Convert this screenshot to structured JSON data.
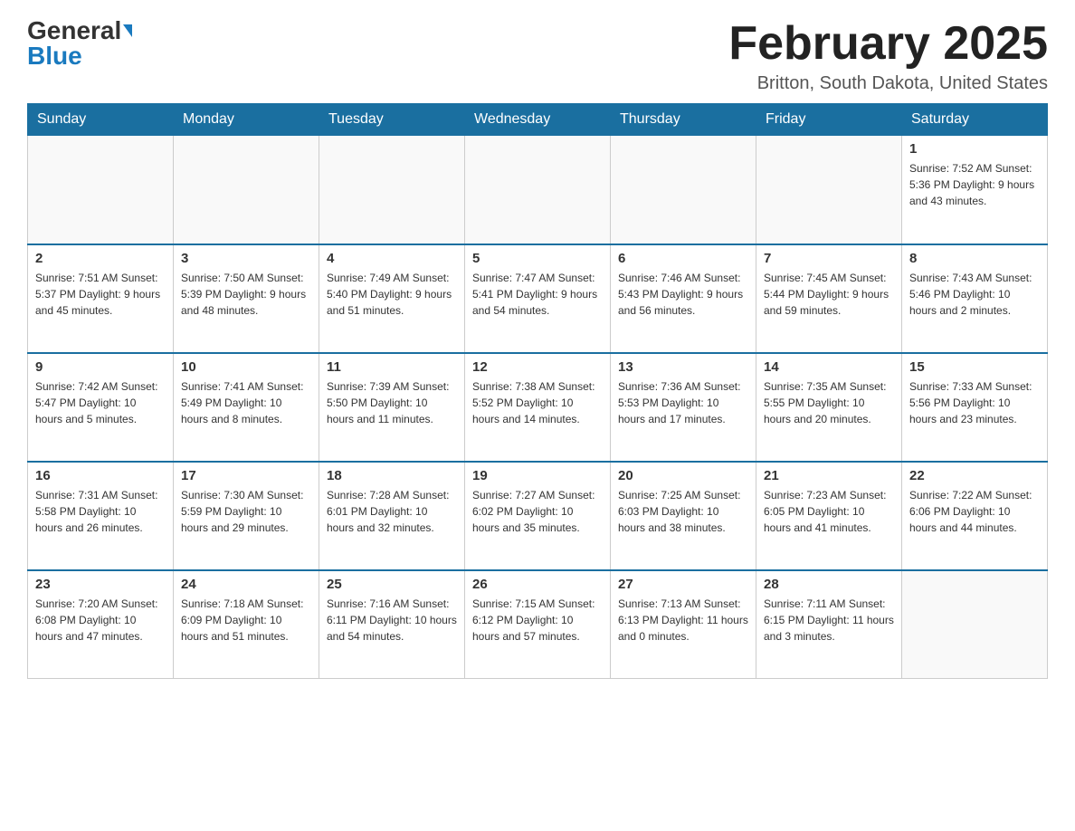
{
  "header": {
    "logo_general": "General",
    "logo_blue": "Blue",
    "month_title": "February 2025",
    "location": "Britton, South Dakota, United States"
  },
  "days_of_week": [
    "Sunday",
    "Monday",
    "Tuesday",
    "Wednesday",
    "Thursday",
    "Friday",
    "Saturday"
  ],
  "weeks": [
    [
      {
        "day": "",
        "info": ""
      },
      {
        "day": "",
        "info": ""
      },
      {
        "day": "",
        "info": ""
      },
      {
        "day": "",
        "info": ""
      },
      {
        "day": "",
        "info": ""
      },
      {
        "day": "",
        "info": ""
      },
      {
        "day": "1",
        "info": "Sunrise: 7:52 AM\nSunset: 5:36 PM\nDaylight: 9 hours and 43 minutes."
      }
    ],
    [
      {
        "day": "2",
        "info": "Sunrise: 7:51 AM\nSunset: 5:37 PM\nDaylight: 9 hours and 45 minutes."
      },
      {
        "day": "3",
        "info": "Sunrise: 7:50 AM\nSunset: 5:39 PM\nDaylight: 9 hours and 48 minutes."
      },
      {
        "day": "4",
        "info": "Sunrise: 7:49 AM\nSunset: 5:40 PM\nDaylight: 9 hours and 51 minutes."
      },
      {
        "day": "5",
        "info": "Sunrise: 7:47 AM\nSunset: 5:41 PM\nDaylight: 9 hours and 54 minutes."
      },
      {
        "day": "6",
        "info": "Sunrise: 7:46 AM\nSunset: 5:43 PM\nDaylight: 9 hours and 56 minutes."
      },
      {
        "day": "7",
        "info": "Sunrise: 7:45 AM\nSunset: 5:44 PM\nDaylight: 9 hours and 59 minutes."
      },
      {
        "day": "8",
        "info": "Sunrise: 7:43 AM\nSunset: 5:46 PM\nDaylight: 10 hours and 2 minutes."
      }
    ],
    [
      {
        "day": "9",
        "info": "Sunrise: 7:42 AM\nSunset: 5:47 PM\nDaylight: 10 hours and 5 minutes."
      },
      {
        "day": "10",
        "info": "Sunrise: 7:41 AM\nSunset: 5:49 PM\nDaylight: 10 hours and 8 minutes."
      },
      {
        "day": "11",
        "info": "Sunrise: 7:39 AM\nSunset: 5:50 PM\nDaylight: 10 hours and 11 minutes."
      },
      {
        "day": "12",
        "info": "Sunrise: 7:38 AM\nSunset: 5:52 PM\nDaylight: 10 hours and 14 minutes."
      },
      {
        "day": "13",
        "info": "Sunrise: 7:36 AM\nSunset: 5:53 PM\nDaylight: 10 hours and 17 minutes."
      },
      {
        "day": "14",
        "info": "Sunrise: 7:35 AM\nSunset: 5:55 PM\nDaylight: 10 hours and 20 minutes."
      },
      {
        "day": "15",
        "info": "Sunrise: 7:33 AM\nSunset: 5:56 PM\nDaylight: 10 hours and 23 minutes."
      }
    ],
    [
      {
        "day": "16",
        "info": "Sunrise: 7:31 AM\nSunset: 5:58 PM\nDaylight: 10 hours and 26 minutes."
      },
      {
        "day": "17",
        "info": "Sunrise: 7:30 AM\nSunset: 5:59 PM\nDaylight: 10 hours and 29 minutes."
      },
      {
        "day": "18",
        "info": "Sunrise: 7:28 AM\nSunset: 6:01 PM\nDaylight: 10 hours and 32 minutes."
      },
      {
        "day": "19",
        "info": "Sunrise: 7:27 AM\nSunset: 6:02 PM\nDaylight: 10 hours and 35 minutes."
      },
      {
        "day": "20",
        "info": "Sunrise: 7:25 AM\nSunset: 6:03 PM\nDaylight: 10 hours and 38 minutes."
      },
      {
        "day": "21",
        "info": "Sunrise: 7:23 AM\nSunset: 6:05 PM\nDaylight: 10 hours and 41 minutes."
      },
      {
        "day": "22",
        "info": "Sunrise: 7:22 AM\nSunset: 6:06 PM\nDaylight: 10 hours and 44 minutes."
      }
    ],
    [
      {
        "day": "23",
        "info": "Sunrise: 7:20 AM\nSunset: 6:08 PM\nDaylight: 10 hours and 47 minutes."
      },
      {
        "day": "24",
        "info": "Sunrise: 7:18 AM\nSunset: 6:09 PM\nDaylight: 10 hours and 51 minutes."
      },
      {
        "day": "25",
        "info": "Sunrise: 7:16 AM\nSunset: 6:11 PM\nDaylight: 10 hours and 54 minutes."
      },
      {
        "day": "26",
        "info": "Sunrise: 7:15 AM\nSunset: 6:12 PM\nDaylight: 10 hours and 57 minutes."
      },
      {
        "day": "27",
        "info": "Sunrise: 7:13 AM\nSunset: 6:13 PM\nDaylight: 11 hours and 0 minutes."
      },
      {
        "day": "28",
        "info": "Sunrise: 7:11 AM\nSunset: 6:15 PM\nDaylight: 11 hours and 3 minutes."
      },
      {
        "day": "",
        "info": ""
      }
    ]
  ]
}
